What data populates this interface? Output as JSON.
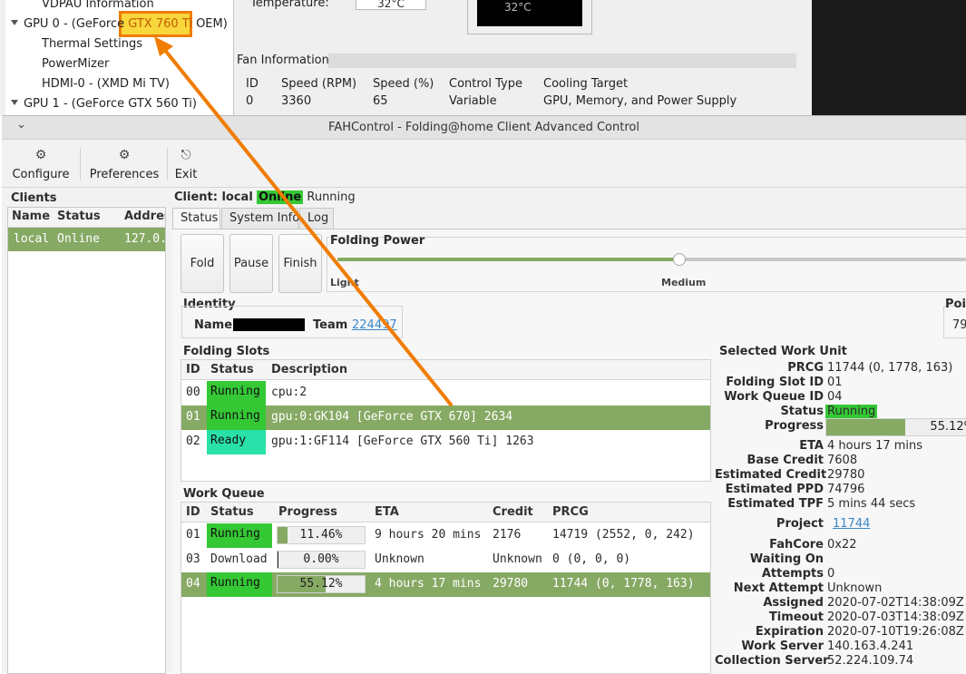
{
  "bg_window": {
    "tree": {
      "vdpau": "VDPAU Information",
      "gpu0_prefix": "GPU 0 - (GeForce ",
      "gpu0_highlight": "GTX 760 Ti",
      "gpu0_suffix": " OEM)",
      "thermal": "Thermal Settings",
      "powermizer": "PowerMizer",
      "hdmi": "HDMI-0 - (XMD Mi TV)",
      "gpu1": "GPU 1 - (GeForce GTX 560 Ti)"
    },
    "temperature_label": "Temperature:",
    "temperature_value": "32°C",
    "gauge_value": "32°C",
    "fan_info": {
      "title": "Fan Information",
      "headers": [
        "ID",
        "Speed (RPM)",
        "Speed (%)",
        "Control Type",
        "Cooling Target"
      ],
      "row": [
        "0",
        "3360",
        "65",
        "Variable",
        "GPU, Memory, and Power Supply"
      ]
    }
  },
  "window": {
    "title": "FAHControl - Folding@home Client Advanced Control",
    "menu_glyph": "⌄"
  },
  "toolbar": {
    "configure": "Configure",
    "preferences": "Preferences",
    "exit": "Exit",
    "configure_icon": "gear-icon",
    "preferences_icon": "gear-icon",
    "exit_icon": "exit-icon"
  },
  "clients": {
    "title": "Clients",
    "headers": [
      "Name",
      "Status",
      "Address"
    ],
    "row": {
      "name": "local",
      "status": "Online",
      "address": "127.0."
    }
  },
  "client": {
    "prefix": "Client: local",
    "online": "Online",
    "running": "Running"
  },
  "tabs": [
    "Status",
    "System Info",
    "Log"
  ],
  "fold_buttons": [
    "Fold",
    "Pause",
    "Finish"
  ],
  "folding_power": {
    "title": "Folding Power",
    "light": "Light",
    "medium": "Medium",
    "level": "medium"
  },
  "identity": {
    "title": "Identity",
    "name_label": "Name",
    "team_label": "Team",
    "team_value": "224497"
  },
  "points": {
    "title": "Poi",
    "value": "79"
  },
  "folding_slots": {
    "title": "Folding Slots",
    "headers": [
      "ID",
      "Status",
      "Description"
    ],
    "rows": [
      {
        "id": "00",
        "status": "Running",
        "desc": "cpu:2"
      },
      {
        "id": "01",
        "status": "Running",
        "desc": "gpu:0:GK104 [GeForce GTX 670] 2634"
      },
      {
        "id": "02",
        "status": "Ready",
        "desc": "gpu:1:GF114 [GeForce GTX 560 Ti] 1263"
      }
    ]
  },
  "work_queue": {
    "title": "Work Queue",
    "headers": [
      "ID",
      "Status",
      "Progress",
      "ETA",
      "Credit",
      "PRCG"
    ],
    "rows": [
      {
        "id": "01",
        "status": "Running",
        "progress": "11.46%",
        "progress_value": 0.1146,
        "eta": "9 hours 20 mins",
        "credit": "2176",
        "prcg": "14719 (2552, 0, 242)"
      },
      {
        "id": "03",
        "status": "Download",
        "progress": "0.00%",
        "progress_value": 0.0,
        "eta": "Unknown",
        "credit": "Unknown",
        "prcg": "0 (0, 0, 0)"
      },
      {
        "id": "04",
        "status": "Running",
        "progress": "55.12%",
        "progress_value": 0.5512,
        "eta": "4 hours 17 mins",
        "credit": "29780",
        "prcg": "11744 (0, 1778, 163)"
      }
    ]
  },
  "selected_wu": {
    "title": "Selected Work Unit",
    "fields": [
      {
        "key": "PRCG",
        "value": "11744 (0, 1778, 163)"
      },
      {
        "key": "Folding Slot ID",
        "value": "01"
      },
      {
        "key": "Work Queue ID",
        "value": "04"
      },
      {
        "key": "Status",
        "value": "Running"
      },
      {
        "key": "Progress",
        "value": "55.12%"
      },
      {
        "key": "ETA",
        "value": "4 hours 17 mins"
      },
      {
        "key": "Base Credit",
        "value": "7608"
      },
      {
        "key": "Estimated Credit",
        "value": "29780"
      },
      {
        "key": "Estimated PPD",
        "value": "74796"
      },
      {
        "key": "Estimated TPF",
        "value": "5 mins 44 secs"
      },
      {
        "key": "Project",
        "value": "11744"
      },
      {
        "key": "FahCore",
        "value": "0x22"
      },
      {
        "key": "Waiting On",
        "value": ""
      },
      {
        "key": "Attempts",
        "value": "0"
      },
      {
        "key": "Next Attempt",
        "value": "Unknown"
      },
      {
        "key": "Assigned",
        "value": "2020-07-02T14:38:09Z"
      },
      {
        "key": "Timeout",
        "value": "2020-07-03T14:38:09Z"
      },
      {
        "key": "Expiration",
        "value": "2020-07-10T19:26:08Z"
      },
      {
        "key": "Work Server",
        "value": "140.163.4.241"
      },
      {
        "key": "Collection Server",
        "value": "52.224.109.74"
      }
    ],
    "progress_value": 0.5512
  },
  "colors": {
    "accent_green": "#86a964",
    "running_green": "#35c835",
    "ready_teal": "#28e0a8",
    "annotation_orange": "#f07c00"
  }
}
